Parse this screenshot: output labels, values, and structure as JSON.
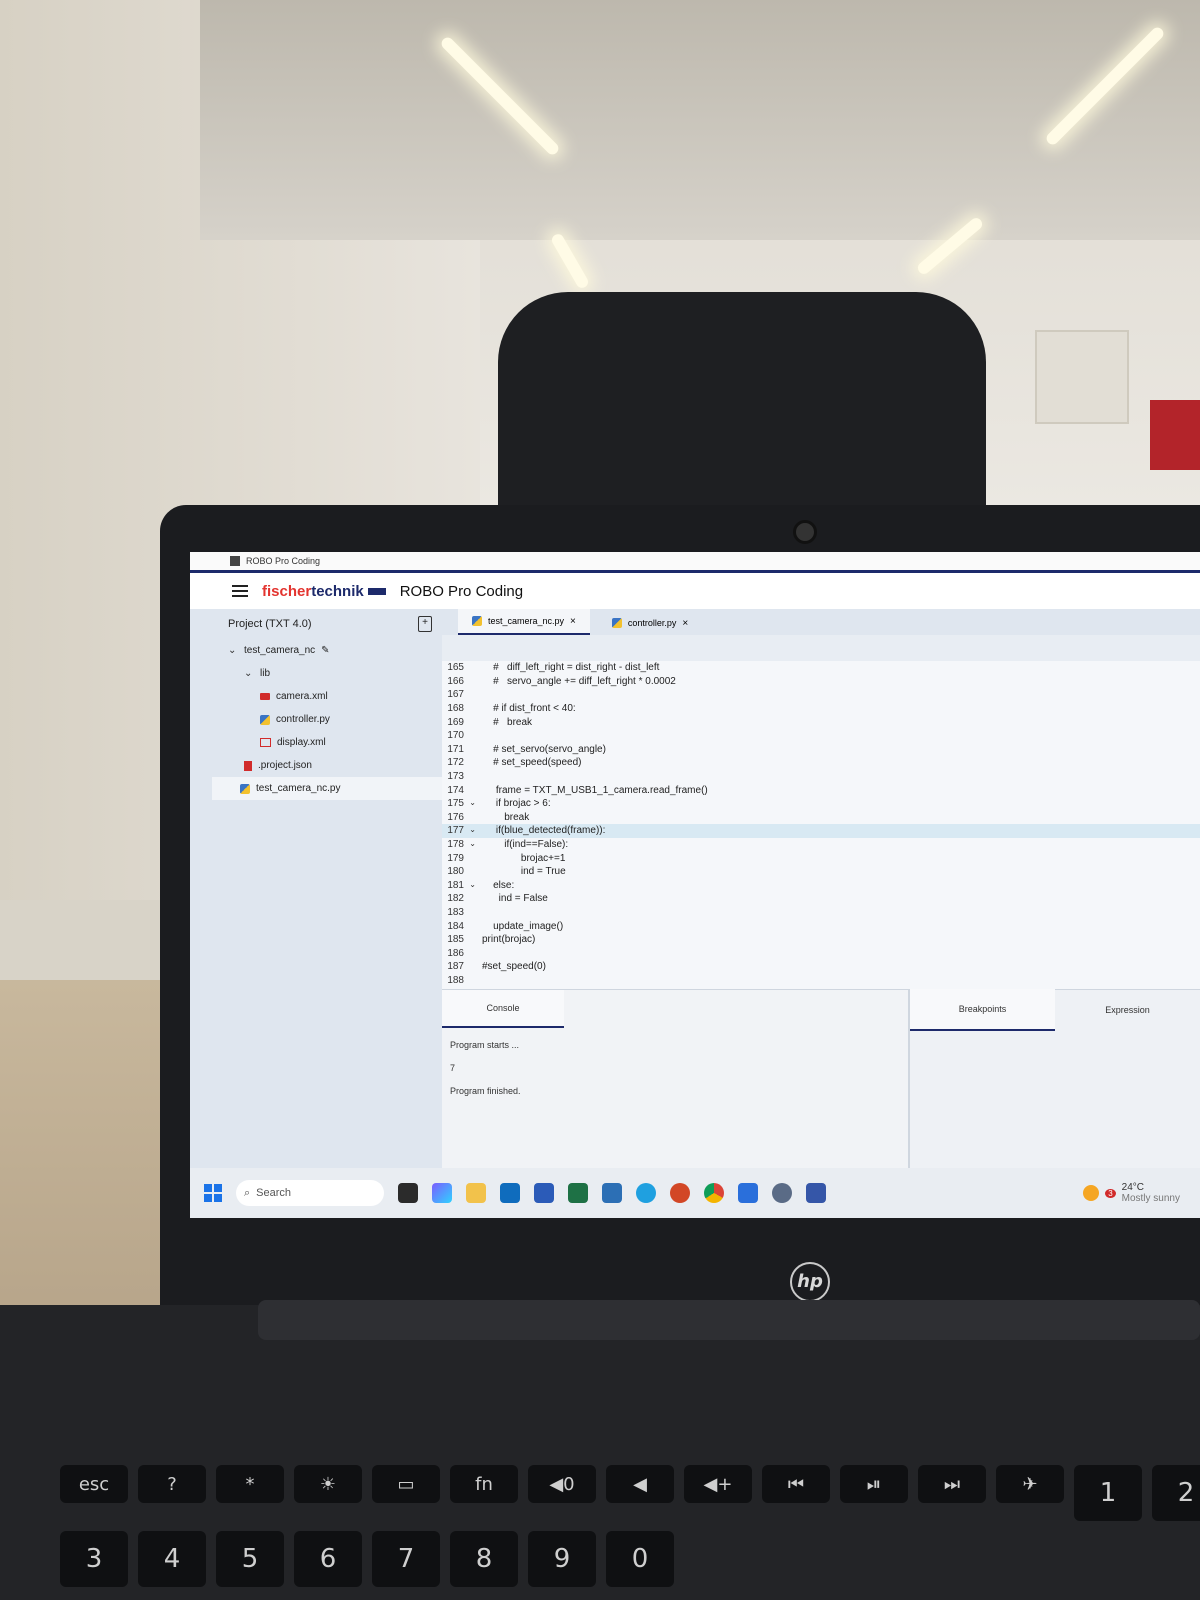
{
  "window": {
    "title": "ROBO Pro Coding"
  },
  "header": {
    "brand_part1": "fischer",
    "brand_part2": "technik",
    "app_title": "ROBO Pro Coding"
  },
  "sidebar": {
    "project_label": "Project (TXT 4.0)",
    "items": [
      {
        "label": "test_camera_nc",
        "icon": "chevron-down-icon"
      },
      {
        "label": "lib",
        "icon": "chevron-down-icon"
      },
      {
        "label": "camera.xml",
        "icon": "camera-icon"
      },
      {
        "label": "controller.py",
        "icon": "python-icon"
      },
      {
        "label": "display.xml",
        "icon": "display-icon"
      },
      {
        "label": ".project.json",
        "icon": "json-icon"
      },
      {
        "label": "test_camera_nc.py",
        "icon": "python-icon"
      }
    ]
  },
  "tabs": [
    {
      "label": "test_camera_nc.py",
      "close": "×"
    },
    {
      "label": "controller.py",
      "close": "×"
    }
  ],
  "code": [
    {
      "n": "165",
      "text": "    #   diff_left_right = dist_right - dist_left"
    },
    {
      "n": "166",
      "text": "    #   servo_angle += diff_left_right * 0.0002"
    },
    {
      "n": "167",
      "text": ""
    },
    {
      "n": "168",
      "text": "    # if dist_front < 40:"
    },
    {
      "n": "169",
      "text": "    #   break"
    },
    {
      "n": "170",
      "text": ""
    },
    {
      "n": "171",
      "text": "    # set_servo(servo_angle)"
    },
    {
      "n": "172",
      "text": "    # set_speed(speed)"
    },
    {
      "n": "173",
      "text": ""
    },
    {
      "n": "174",
      "text": "     frame = TXT_M_USB1_1_camera.read_frame()"
    },
    {
      "n": "175",
      "text": "     if brojac > 6:"
    },
    {
      "n": "176",
      "text": "        break"
    },
    {
      "n": "177",
      "text": "     if(blue_detected(frame)):"
    },
    {
      "n": "178",
      "text": "        if(ind==False):"
    },
    {
      "n": "179",
      "text": "              brojac+=1"
    },
    {
      "n": "180",
      "text": "              ind = True"
    },
    {
      "n": "181",
      "text": "    else:"
    },
    {
      "n": "182",
      "text": "      ind = False"
    },
    {
      "n": "183",
      "text": ""
    },
    {
      "n": "184",
      "text": "    update_image()"
    },
    {
      "n": "185",
      "text": "print(brojac)"
    },
    {
      "n": "186",
      "text": ""
    },
    {
      "n": "187",
      "text": "#set_speed(0)"
    },
    {
      "n": "188",
      "text": ""
    }
  ],
  "console": {
    "tab_label": "Console",
    "lines": [
      "Program starts ...",
      "7",
      "Program finished."
    ]
  },
  "debug": {
    "tabs": [
      "Breakpoints",
      "Expression"
    ]
  },
  "taskbar": {
    "search_placeholder": "Search",
    "weather_temp": "24°C",
    "weather_desc": "Mostly sunny",
    "weather_badge": "3"
  },
  "keyboard": {
    "fn_row": [
      "esc",
      "?",
      "*",
      "☀",
      "▭",
      "fn",
      "◀0",
      "◀",
      "◀+",
      "⏮",
      "⏯",
      "⏭",
      "✈"
    ],
    "num_row": [
      "1",
      "2",
      "3",
      "4",
      "5",
      "6",
      "7",
      "8",
      "9",
      "0"
    ]
  },
  "hp_logo": "hp"
}
